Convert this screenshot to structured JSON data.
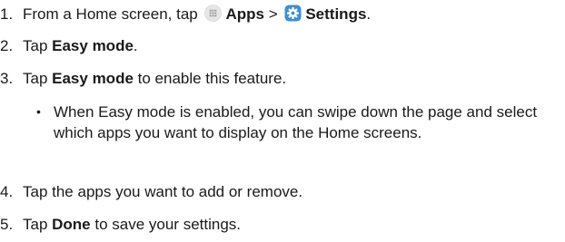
{
  "steps": [
    {
      "number": "1.",
      "prefix": "From a Home screen, tap ",
      "apps_label": "Apps",
      "separator": " > ",
      "settings_label": "Settings",
      "suffix": "."
    },
    {
      "number": "2.",
      "prefix": "Tap ",
      "bold": "Easy mode",
      "suffix": "."
    },
    {
      "number": "3.",
      "prefix": "Tap ",
      "bold": "Easy mode",
      "suffix": " to enable this feature."
    },
    {
      "number": "4.",
      "text": "Tap the apps you want to add or remove."
    },
    {
      "number": "5.",
      "prefix": "Tap ",
      "bold": "Done",
      "suffix": " to save your settings."
    }
  ],
  "bullet": {
    "symbol": "•",
    "text": "When Easy mode is enabled, you can swipe down the page and select which apps you want to display on the Home screens."
  },
  "icons": {
    "apps": "apps-grid-icon",
    "settings": "settings-gear-icon"
  },
  "colors": {
    "text": "#1a1a1a",
    "settings_icon_bg": "#3d8fd6",
    "apps_icon_bg": "#e6e6e6"
  }
}
